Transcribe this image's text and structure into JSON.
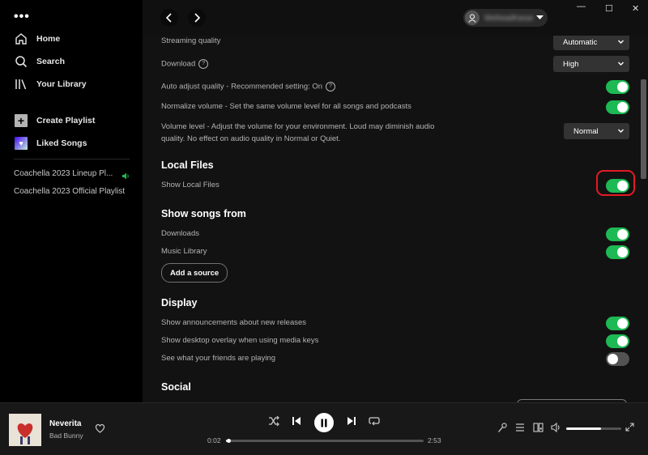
{
  "sidebar": {
    "menu_glyph": "•••",
    "nav": [
      {
        "label": "Home",
        "icon": "home-icon"
      },
      {
        "label": "Search",
        "icon": "search-icon"
      },
      {
        "label": "Your Library",
        "icon": "library-icon"
      }
    ],
    "actions": [
      {
        "label": "Create Playlist",
        "icon": "plus-icon"
      },
      {
        "label": "Liked Songs",
        "icon": "heart-icon"
      }
    ],
    "playlists": [
      {
        "label": "Coachella 2023 Lineup Pl...",
        "playing": true
      },
      {
        "label": "Coachella 2023 Official Playlist",
        "playing": false
      }
    ]
  },
  "topbar": {
    "back_icon": "chevron-left-icon",
    "forward_icon": "chevron-right-icon",
    "user_name": "WelheadKassel",
    "window_controls": [
      "—",
      "☐",
      "✕"
    ]
  },
  "settings": {
    "streaming_quality": {
      "label": "Streaming quality",
      "value": "Automatic"
    },
    "download": {
      "label": "Download",
      "value": "High"
    },
    "auto_adjust": {
      "label": "Auto adjust quality - Recommended setting: On",
      "on": true
    },
    "normalize": {
      "label": "Normalize volume - Set the same volume level for all songs and podcasts",
      "on": true
    },
    "volume_level": {
      "label_line1": "Volume level - Adjust the volume for your environment. Loud may diminish audio",
      "label_line2": "quality. No effect on audio quality in Normal or Quiet.",
      "value": "Normal"
    },
    "local_files": {
      "heading": "Local Files",
      "show_label": "Show Local Files",
      "on": true
    },
    "show_songs_from": {
      "heading": "Show songs from",
      "downloads": "Downloads",
      "music_library": "Music Library",
      "add_source": "Add a source"
    },
    "display": {
      "heading": "Display",
      "announcements": {
        "label": "Show announcements about new releases",
        "on": true
      },
      "overlay": {
        "label": "Show desktop overlay when using media keys",
        "on": true
      },
      "friends": {
        "label": "See what your friends are playing",
        "on": false
      }
    },
    "social": {
      "heading": "Social"
    }
  },
  "player": {
    "title": "Neverita",
    "artist": "Bad Bunny",
    "elapsed": "0:02",
    "duration": "2:53",
    "progress_fraction": 0.012,
    "volume_fraction": 0.63
  },
  "colors": {
    "accent": "#1db954",
    "highlight": "#e31b23",
    "background": "#121212"
  }
}
